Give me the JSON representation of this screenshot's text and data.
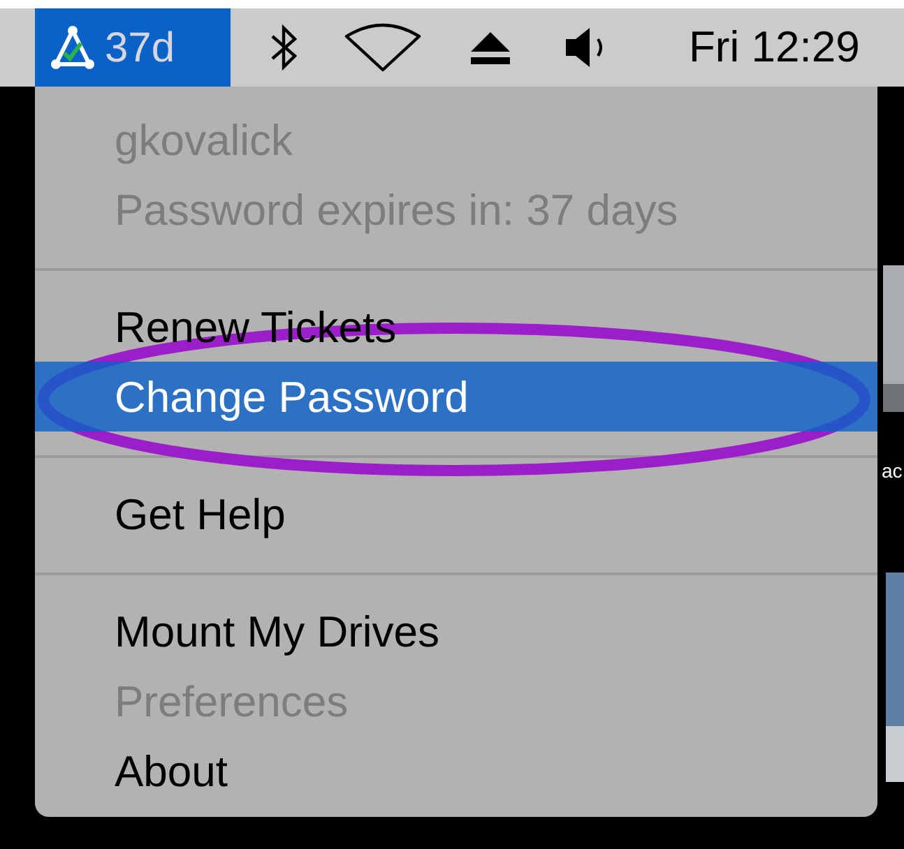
{
  "menu_bar": {
    "app_status": {
      "label": "37d",
      "selected": true
    },
    "clock": "Fri 12:29"
  },
  "menu": {
    "groups": [
      {
        "items": [
          {
            "label": "gkovalick",
            "disabled": true,
            "selected": false
          },
          {
            "label": "Password expires in: 37 days",
            "disabled": true,
            "selected": false
          }
        ]
      },
      {
        "items": [
          {
            "label": "Renew Tickets",
            "disabled": false,
            "selected": false
          },
          {
            "label": "Change Password",
            "disabled": false,
            "selected": true
          }
        ]
      },
      {
        "items": [
          {
            "label": "Get Help",
            "disabled": false,
            "selected": false
          }
        ]
      },
      {
        "items": [
          {
            "label": "Mount My Drives",
            "disabled": false,
            "selected": false
          },
          {
            "label": "Preferences",
            "disabled": true,
            "selected": false
          },
          {
            "label": "About",
            "disabled": false,
            "selected": false
          }
        ]
      }
    ]
  },
  "annotation": {
    "kind": "ellipse",
    "color": "#9a1fc9"
  },
  "desktop": {
    "label": "ac"
  }
}
